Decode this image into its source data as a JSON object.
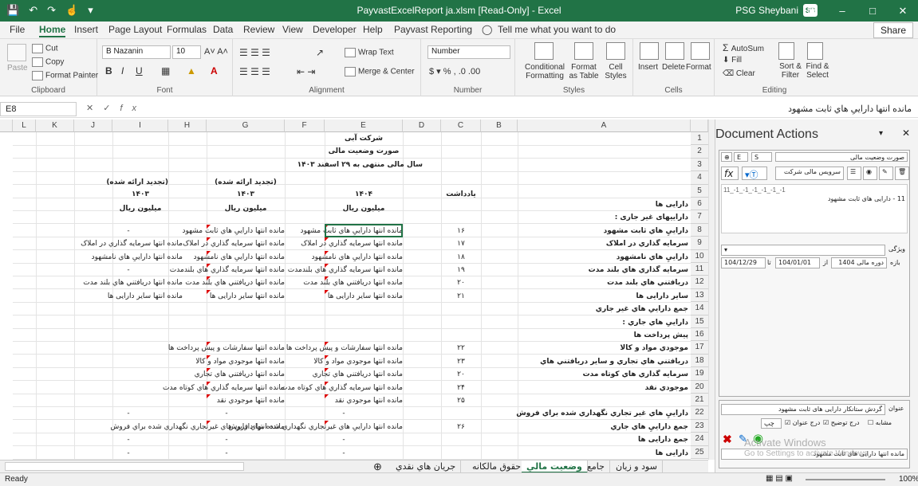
{
  "titlebar": {
    "title": "PayvastExcelReport ja.xlsm  [Read-Only]  -  Excel",
    "user": "PSG Sheybani",
    "avatar": "SB"
  },
  "tabs": [
    "File",
    "Home",
    "Insert",
    "Page Layout",
    "Formulas",
    "Data",
    "Review",
    "View",
    "Developer",
    "Help",
    "Payvast Reporting"
  ],
  "tell_me": "Tell me what you want to do",
  "share": "Share",
  "ribbon": {
    "clipboard": {
      "label": "Clipboard",
      "paste": "Paste",
      "cut": "Cut",
      "copy": "Copy",
      "format_painter": "Format Painter"
    },
    "font": {
      "label": "Font",
      "name": "B Nazanin",
      "size": "10"
    },
    "alignment": {
      "label": "Alignment",
      "wrap": "Wrap Text",
      "merge": "Merge & Center"
    },
    "number": {
      "label": "Number",
      "format": "Number"
    },
    "styles": {
      "label": "Styles",
      "cond": "Conditional Formatting",
      "table": "Format as Table",
      "cell": "Cell Styles"
    },
    "cells": {
      "label": "Cells",
      "insert": "Insert",
      "delete": "Delete",
      "format": "Format"
    },
    "editing": {
      "label": "Editing",
      "autosum": "AutoSum",
      "fill": "Fill",
      "clear": "Clear",
      "sort": "Sort & Filter",
      "find": "Find & Select"
    }
  },
  "formula_bar": {
    "name_box": "E8",
    "content": "مانده انتها    داراییِ هاي ثابت مشهود"
  },
  "columns": [
    "L",
    "K",
    "J",
    "I",
    "H",
    "G",
    "F",
    "E",
    "D",
    "C",
    "B",
    "A"
  ],
  "rows": [
    "1",
    "2",
    "3",
    "4",
    "5",
    "6",
    "7",
    "8",
    "9",
    "10",
    "11",
    "12",
    "13",
    "14",
    "15",
    "16",
    "17",
    "18",
    "19",
    "20",
    "21",
    "22",
    "23",
    "24",
    "25"
  ],
  "sheet": {
    "company": "شرکت آبی",
    "report": "صورت وضعيت مالی",
    "period": "سال مالی منتهی به ۲۹ اسفند ۱۴۰۳",
    "restated_i": "(تجديد ارائه شده)",
    "restated_g": "(تجديد ارائه شده)",
    "year_i": "۱۴۰۳",
    "year_g": "۱۴۰۳",
    "year_e": "۱۴۰۴",
    "note_hdr": "يادداشت",
    "unit_i": "ميليون ريال",
    "unit_g": "ميليون ريال",
    "unit_e": "ميليون ريال",
    "labels": [
      "دارايی ها",
      "دارايیهای غير جاری :",
      "داراييِ هاي ثابت مشهود",
      "سرمايه گذاري در املاک",
      "داراييِ هاي نامشهود",
      "سرمايه گذاري هاي بلند مدت",
      "دريافتني هاي بلند مدت",
      "سایر دارایی ها",
      "جمع داراییِ هاي غير جاري",
      "دارايیِ هاي جاري :",
      "پيش پرداخت ها",
      "موجودي مواد و کالا",
      "دريافتني هاي تجاري و ساير دريافتني هاي",
      "سرمايه گذاري هاي کوتاه مدت",
      "موجودي نقد",
      "",
      "داراييِ هاي غير تجاري نگهداري شده براي فروش",
      "جمع داراييِ هاي  جاري",
      "جمع دارايی ها",
      "دارايی ها"
    ],
    "notes": [
      "۱۶",
      "۱۷",
      "۱۸",
      "۱۹",
      "۲۰",
      "۲۱",
      "",
      "",
      "",
      "۲۲",
      "۲۳",
      "۲۰",
      "۲۴",
      "۲۵",
      "",
      "۲۶",
      "",
      "",
      ""
    ],
    "e_vals": [
      "مانده انتها    داراییِ هاي ثابت مشهود",
      "مانده انتها    سرمايه گذاري در املاک",
      "مانده انتها    داراییِ هاي نامشهود",
      "مانده انتها    سرمايه گذاري هاي بلندمدت",
      "مانده انتها    دريافتني هاي بلند مدت",
      "مانده انتها    سایر دارایی ها",
      "",
      "",
      "",
      "مانده انتها    سفارشات و پيش پرداخت ها",
      "مانده انتها    موجودي مواد و کالا",
      "مانده انتها    دريافتني هاي تجاري",
      "مانده انتها    سرمايه گذاري هاي کوتاه مدت",
      "مانده انتها    موجودي نقد",
      "-",
      "مانده انتها    داراییِ هاي غيرتجاري نگهداري شده براي فروش",
      "-",
      "-",
      ""
    ],
    "g_vals": [
      "مانده انتها    داراییِ هاي ثابت مشهود",
      "مانده انتها    سرمايه گذاري در املاک",
      "مانده انتها    داراییِ هاي نامشهود",
      "مانده انتها    سرمايه گذاري هاي بلندمدت",
      "مانده انتها    دريافتني هاي بلند مدت",
      "مانده انتها    سایر دارایی ها",
      "",
      "",
      "",
      "مانده انتها    سفارشات و پيش پرداخت ها",
      "مانده انتها    موجودي مواد و کالا",
      "مانده انتها    دريافتني هاي تجاري",
      "مانده انتها    سرمايه گذاري هاي کوتاه مدت",
      "مانده انتها    موجودي نقد",
      "-",
      "مانده انتها    داراییِ هاي غيرتجاري نگهداري شده براي فروش",
      "-",
      "-",
      ""
    ],
    "i_vals": [
      "-",
      "مانده انتها    سرمايه گذاري در املاک",
      "مانده انتها    داراییِ هاي نامشهود",
      "-",
      "مانده انتها    دريافتني هاي بلند مدت",
      "مانده انتها    سایر دارایی ها",
      "",
      "",
      "",
      "",
      "",
      "",
      "",
      "",
      "-",
      "",
      "-",
      "-",
      ""
    ]
  },
  "sheet_tabs": [
    "سود و زيان",
    "جامع",
    "وضعيت مالي",
    "حقوق مالکانه",
    "جريان هاي نقدي"
  ],
  "active_tab": "وضعيت مالي",
  "status": {
    "ready": "Ready",
    "zoom": "100%"
  },
  "pane": {
    "title": "Document Actions",
    "combo_a": "E",
    "combo_b": "S",
    "combo_c": "صورت وضعیت مالی",
    "company": "سرویس مالی شرکت",
    "path": "11_-1_-1_-1_-1_-1_-1",
    "item": "11 - دارایی های ثابت مشهود",
    "feature": "ویژگی",
    "range": "بازه",
    "from_lbl": "از",
    "to_lbl": "تا",
    "date_from": "104/01/01",
    "date_to": "104/12/29",
    "fiscal": "دوره مالی 1404",
    "title_lbl": "عنوان",
    "title_val": "گردش ستانکار  دارایی های ثابت مشهود",
    "similar": "مشابه",
    "explain": "درج توضیح",
    "title_insert": "درج عنوان",
    "dir": "چپ",
    "bottom_combo": "مانده انتها    دارایی های ثابت مشهود"
  },
  "activate": {
    "line1": "Activate Windows",
    "line2": "Go to Settings to activate Windows."
  }
}
